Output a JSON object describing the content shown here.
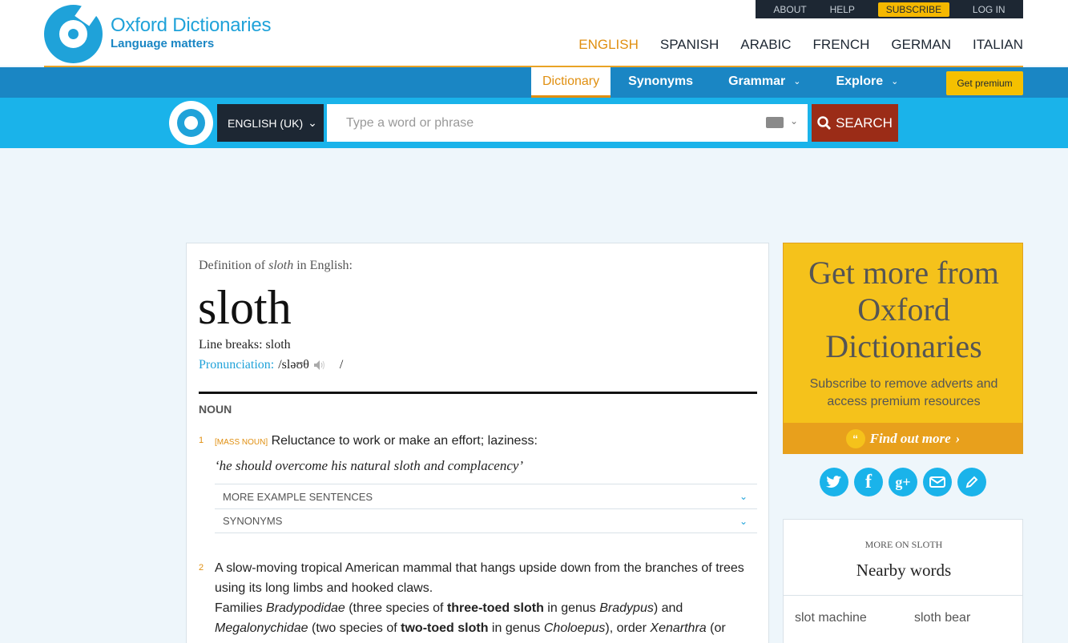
{
  "header": {
    "logo_name": "Oxford Dictionaries",
    "logo_tagline": "Language matters",
    "utility": {
      "about": "ABOUT",
      "help": "HELP",
      "subscribe": "SUBSCRIBE",
      "login": "LOG IN"
    },
    "languages": [
      "ENGLISH",
      "SPANISH",
      "ARABIC",
      "FRENCH",
      "GERMAN",
      "ITALIAN"
    ]
  },
  "nav": {
    "dictionary": "Dictionary",
    "synonyms": "Synonyms",
    "grammar": "Grammar",
    "explore": "Explore",
    "premium": "Get premium"
  },
  "search": {
    "language": "ENGLISH (UK)",
    "placeholder": "Type a word or phrase",
    "button": "SEARCH"
  },
  "entry": {
    "definition_of": "Definition of",
    "word_italic": "sloth",
    "in_english": "in English:",
    "headword": "sloth",
    "line_breaks": "Line breaks: sloth",
    "pron_label": "Pronunciation:",
    "pron_ipa": "/sləʊθ",
    "pron_close": "/",
    "part_of_speech": "NOUN",
    "sense1": {
      "num": "1",
      "grammar": "[MASS NOUN]",
      "text": "Reluctance to work or make an effort; laziness:",
      "example": "‘he should overcome his natural sloth and complacency’",
      "more_examples": "MORE EXAMPLE SENTENCES",
      "synonyms": "SYNONYMS"
    },
    "sense2": {
      "num": "2",
      "text": "A slow-moving tropical American mammal that hangs upside down from the branches of trees using its long limbs and hooked claws.",
      "fam_1": "Families",
      "fam_2": "Bradypodidae",
      "fam_3": "(three species of",
      "fam_4": "three-toed sloth",
      "fam_5": "in genus",
      "fam_6": "Bradypus",
      "fam_7": ") and",
      "fam_8": "Megalonychidae",
      "fam_9": "(two species of",
      "fam_10": "two-toed sloth",
      "fam_11": "in genus",
      "fam_12": "Choloepus",
      "fam_13": "), order",
      "fam_14": "Xenarthra",
      "fam_15": "(or"
    }
  },
  "promo": {
    "title": "Get more from Oxford Dictionaries",
    "subtitle": "Subscribe to remove adverts and access premium resources",
    "cta": "Find out more",
    "cta_arrow": "›"
  },
  "share_icons": [
    "twitter-icon",
    "facebook-icon",
    "googleplus-icon",
    "email-icon",
    "edit-icon"
  ],
  "nearby": {
    "kicker": "MORE ON SLOTH",
    "title": "Nearby words",
    "words": [
      "slot machine",
      "sloth bear"
    ]
  },
  "colors": {
    "brand_blue": "#1fa2d9",
    "nav_blue": "#1a86c4",
    "search_blue": "#1ab3ea",
    "orange": "#e08f10",
    "search_red": "#9b2c17",
    "promo_yellow": "#f5c21b"
  }
}
